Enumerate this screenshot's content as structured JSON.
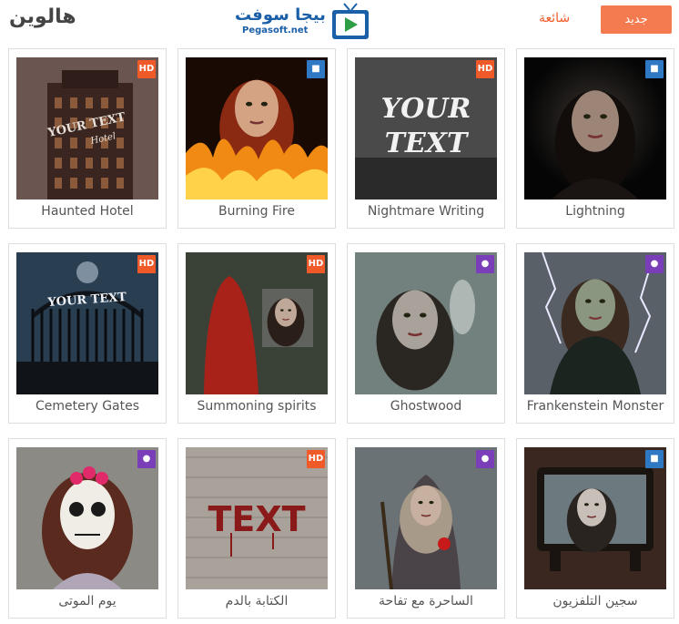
{
  "header": {
    "page_title": "هالوين",
    "logo_text": "بيجا سوفت",
    "logo_sub": "Pegasoft.net",
    "tab_popular": "شائعة",
    "tab_new": "جديد"
  },
  "colors": {
    "accent": "#f47a4f",
    "hd_badge": "#f05a28",
    "video_badge": "#2f78c4",
    "user_badge": "#7a3fb8"
  },
  "effects": [
    {
      "label": "Lightning",
      "badge": "video",
      "theme": "dark-portrait"
    },
    {
      "label": "Nightmare Writing",
      "badge": "HD",
      "theme": "text",
      "thumb_text": [
        "YOUR",
        "TEXT"
      ]
    },
    {
      "label": "Burning Fire",
      "badge": "video",
      "theme": "fire"
    },
    {
      "label": "Haunted Hotel",
      "badge": "HD",
      "theme": "hotel",
      "thumb_text": [
        "YOUR TEXT",
        "Hotel"
      ]
    },
    {
      "label": "Frankenstein Monster",
      "badge": "user",
      "theme": "frank"
    },
    {
      "label": "Ghostwood",
      "badge": "user",
      "theme": "ghost"
    },
    {
      "label": "Summoning spirits",
      "badge": "HD",
      "theme": "red-hood"
    },
    {
      "label": "Cemetery Gates",
      "badge": "HD",
      "theme": "gates",
      "thumb_text": [
        "YOUR TEXT"
      ]
    },
    {
      "label": "سجين التلفزيون",
      "badge": "video",
      "theme": "tv"
    },
    {
      "label": "الساحرة مع تفاحة",
      "badge": "user",
      "theme": "witch"
    },
    {
      "label": "الكتابة بالدم",
      "badge": "HD",
      "theme": "blood",
      "thumb_text": [
        "TEXT"
      ]
    },
    {
      "label": "يوم الموتى",
      "badge": "user",
      "theme": "skull"
    }
  ]
}
